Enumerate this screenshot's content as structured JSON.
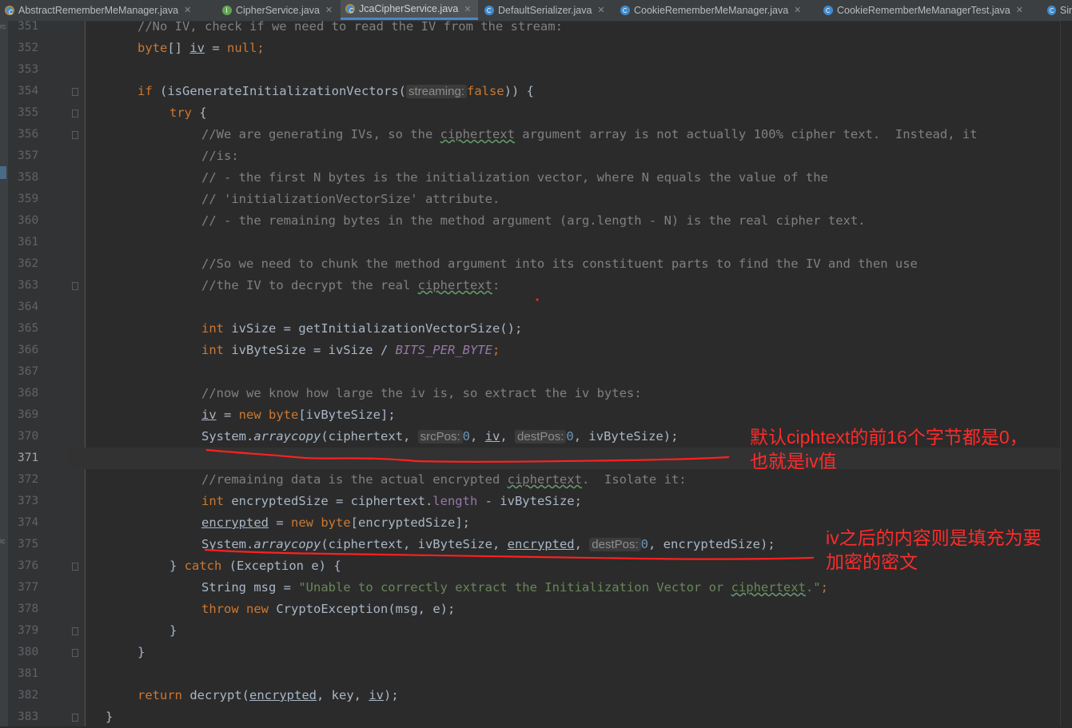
{
  "tabs": [
    {
      "label": "AbstractRememberMeManager.java",
      "icon": "abstract-class-icon",
      "active": false
    },
    {
      "label": "CipherService.java",
      "icon": "interface-icon",
      "active": false
    },
    {
      "label": "JcaCipherService.java",
      "icon": "abstract-class-icon",
      "active": true
    },
    {
      "label": "DefaultSerializer.java",
      "icon": "class-icon",
      "active": false
    },
    {
      "label": "CookieRememberMeManager.java",
      "icon": "class-icon",
      "active": false
    },
    {
      "label": "CookieRememberMeManagerTest.java",
      "icon": "class-icon",
      "active": false
    },
    {
      "label": "Sin",
      "icon": "class-icon",
      "active": false
    }
  ],
  "strip_labels": {
    "top": "rc",
    "mid": "ic"
  },
  "line_numbers": [
    "351",
    "352",
    "353",
    "354",
    "355",
    "356",
    "357",
    "358",
    "359",
    "360",
    "361",
    "362",
    "363",
    "364",
    "365",
    "366",
    "367",
    "368",
    "369",
    "370",
    "371",
    "372",
    "373",
    "374",
    "375",
    "376",
    "377",
    "378",
    "379",
    "380",
    "381",
    "382",
    "383"
  ],
  "current_line": "371",
  "code": {
    "l351": "//No IV, check if we need to read the IV from the stream:",
    "l352_type": "byte",
    "l352_rest1": "[] ",
    "l352_var": "iv",
    "l352_rest2": " = ",
    "l352_null": "null",
    "l352_semi": ";",
    "l354_if": "if",
    "l354_call": " (isGenerateInitializationVectors(",
    "l354_hint": "streaming:",
    "l354_false": "false",
    "l354_end": ")) {",
    "l355_try": "try",
    "l355_brace": " {",
    "l356_a": "//We are generating IVs, so the ",
    "l356_typo": "ciphertext",
    "l356_b": " argument array is not actually 100% cipher text.  Instead, it",
    "l357": "//is:",
    "l358": "// - the first N bytes is the initialization vector, where N equals the value of the",
    "l359": "// 'initializationVectorSize' attribute.",
    "l360": "// - the remaining bytes in the method argument (arg.length - N) is the real cipher text.",
    "l362": "//So we need to chunk the method argument into its constituent parts to find the IV and then use",
    "l363_a": "//the IV to decrypt the real ",
    "l363_typo": "ciphertext",
    "l363_b": ":",
    "l365_int": "int",
    "l365_rest": " ivSize = getInitializationVectorSize();",
    "l366_int": "int",
    "l366_rest": " ivByteSize = ivSize / ",
    "l366_const": "BITS_PER_BYTE",
    "l366_semi": ";",
    "l368": "//now we know how large the iv is, so extract the iv bytes:",
    "l369_var": "iv",
    "l369_eq": " = ",
    "l369_new": "new",
    "l369_byte": " byte",
    "l369_rest": "[ivByteSize];",
    "l370_sys": "System.",
    "l370_method": "arraycopy",
    "l370_a": "(ciphertext, ",
    "l370_hint1": "srcPos:",
    "l370_zero1": "0",
    "l370_b": ", ",
    "l370_iv": "iv",
    "l370_c": ", ",
    "l370_hint2": "destPos:",
    "l370_zero2": "0",
    "l370_d": ", ivByteSize);",
    "l372_a": "//remaining data is the actual encrypted ",
    "l372_typo": "ciphertext",
    "l372_b": ".  Isolate it:",
    "l373_int": "int",
    "l373_a": " encryptedSize = ciphertext.",
    "l373_field": "length",
    "l373_b": " - ivByteSize;",
    "l374_var": "encrypted",
    "l374_eq": " = ",
    "l374_new": "new",
    "l374_byte": " byte",
    "l374_rest": "[encryptedSize];",
    "l375_sys": "System.",
    "l375_method": "arraycopy",
    "l375_a": "(ciphertext, ivByteSize, ",
    "l375_var": "encrypted",
    "l375_b": ", ",
    "l375_hint": "destPos:",
    "l375_zero": "0",
    "l375_c": ", encryptedSize);",
    "l376_a": "} ",
    "l376_catch": "catch",
    "l376_b": " (Exception e) {",
    "l377_a": "String msg = ",
    "l377_str1": "\"Unable to correctly extract the Initialization Vector or ",
    "l377_typo": "ciphertext",
    "l377_str2": ".\"",
    "l377_semi": ";",
    "l378_throw": "throw",
    "l378_sp": " ",
    "l378_new": "new",
    "l378_rest": " CryptoException(msg, e);",
    "l379": "}",
    "l380": "}",
    "l382_return": "return",
    "l382_a": " decrypt(",
    "l382_enc": "encrypted",
    "l382_b": ", key, ",
    "l382_iv": "iv",
    "l382_c": ");",
    "l383": "}"
  },
  "annotations": {
    "note1_line1": "默认ciphtext的前16个字节都是0，",
    "note1_line2": "也就是iv值",
    "note2_line1": "iv之后的内容则是填充为要",
    "note2_line2": "加密的密文",
    "color": "#ff2b2b"
  },
  "colors": {
    "background": "#2b2b2b",
    "gutter": "#313335",
    "keyword": "#cc7832",
    "comment": "#808080",
    "string": "#6a8759",
    "number": "#6897bb",
    "field": "#9876aa",
    "text": "#a9b7c6"
  }
}
